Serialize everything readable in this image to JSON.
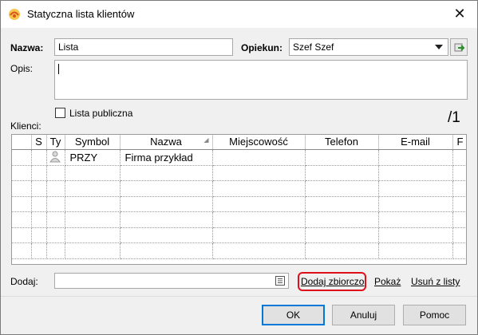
{
  "window": {
    "title": "Statyczna lista klientów",
    "app_icon": "app-logo-icon",
    "close_icon": "close-icon"
  },
  "form": {
    "name_label": "Nazwa:",
    "name_value": "Lista",
    "owner_label": "Opiekun:",
    "owner_value": "Szef Szef",
    "description_label": "Opis:",
    "description_value": "",
    "public_label": "Lista publiczna",
    "public_checked": false,
    "clients_label": "Klienci:",
    "counter": "/1"
  },
  "grid": {
    "columns": [
      "S",
      "Ty",
      "Symbol",
      "Nazwa",
      "Miejscowość",
      "Telefon",
      "E-mail",
      "F"
    ],
    "rows": [
      {
        "symbol": "PRZY",
        "name": "Firma przykład",
        "type_icon": "client-type-icon"
      }
    ]
  },
  "add": {
    "label": "Dodaj:",
    "value": "",
    "bulk_link": "Dodaj zbiorczo",
    "show_link": "Pokaż",
    "remove_link": "Usuń z listy"
  },
  "buttons": {
    "ok": "OK",
    "cancel": "Anuluj",
    "help": "Pomoc"
  },
  "colors": {
    "highlight": "#e0101a",
    "accent": "#0078d7"
  }
}
